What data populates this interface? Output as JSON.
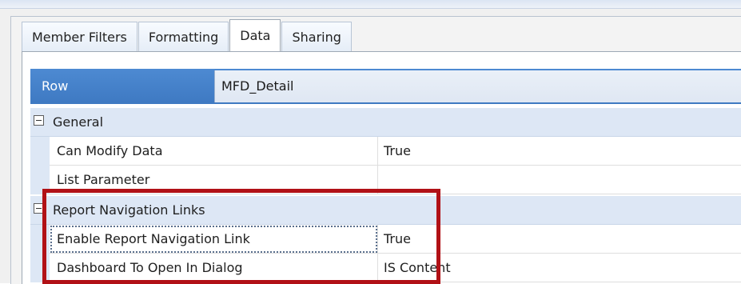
{
  "tabs": [
    {
      "label": "Member Filters",
      "active": false
    },
    {
      "label": "Formatting",
      "active": false
    },
    {
      "label": "Data",
      "active": true
    },
    {
      "label": "Sharing",
      "active": false
    }
  ],
  "row_header": {
    "label": "Row",
    "value": "MFD_Detail"
  },
  "sections": [
    {
      "title": "General",
      "properties": [
        {
          "name": "Can Modify Data",
          "value": "True"
        },
        {
          "name": "List Parameter",
          "value": ""
        }
      ]
    },
    {
      "title": "Report Navigation Links",
      "properties": [
        {
          "name": "Enable Report Navigation Link",
          "value": "True"
        },
        {
          "name": "Dashboard To Open In Dialog",
          "value": "IS Content"
        }
      ]
    }
  ],
  "colors": {
    "header_blue": "#4583cc",
    "section_band": "#dde7f5",
    "highlight_red": "#b11116"
  }
}
